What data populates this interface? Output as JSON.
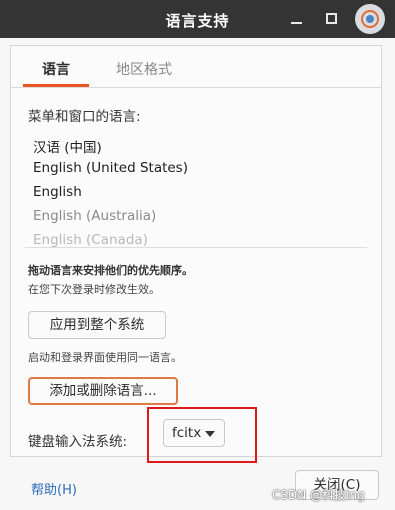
{
  "window": {
    "title": "语言支持",
    "minimize_icon": "minimize-icon",
    "maximize_icon": "maximize-icon",
    "avatar_icon": "user-avatar-icon"
  },
  "tabs": [
    {
      "label": "语言",
      "selected": true
    },
    {
      "label": "地区格式",
      "selected": false
    }
  ],
  "accent_color": "#e95420",
  "language_section": {
    "label": "菜单和窗口的语言:",
    "languages": [
      "汉语 (中国)",
      "English (United States)",
      "English",
      "English (Australia)",
      "English (Canada)"
    ],
    "drag_hint": "拖动语言来安排他们的优先顺序。",
    "relogin_hint": "在您下次登录时修改生效。",
    "apply_button": "应用到整个系统",
    "login_screen_hint": "启动和登录界面使用同一语言。",
    "add_remove_button": "添加或删除语言..."
  },
  "input_method": {
    "label": "键盘输入法系统:",
    "selected": "fcitx",
    "highlight_color": "#e01a1a"
  },
  "footer": {
    "help": "帮助(H)",
    "close": "关闭(C)"
  },
  "watermark": "CSDN @科技ing"
}
